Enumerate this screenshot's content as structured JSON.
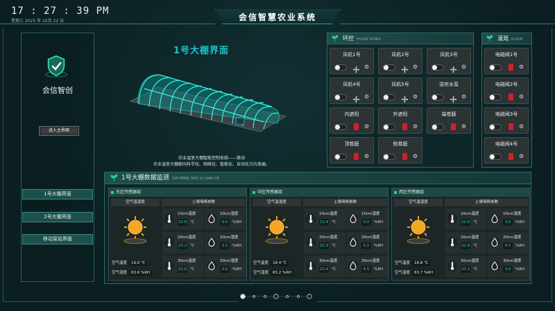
{
  "header": {
    "time": "17 : 27 : 39  PM",
    "date": "星期三    2025 年 10月 22 日",
    "title": "会信智慧农业系统"
  },
  "left": {
    "brand": "会信智创",
    "enter_button": "进入主界面",
    "nav": [
      "1号大棚界面",
      "2号大棚界面",
      "移动泵站界面"
    ]
  },
  "greenhouse": {
    "title": "1号大棚界面",
    "desc_line1": "农业温室大棚智能控制系统——推动",
    "desc_line2": "农业温室大棚朝向科学化、网络化、智能化、自动化方向发展。"
  },
  "env": {
    "title": "环控",
    "subtitle": "HUAN KONG",
    "items": [
      {
        "label": "风机1号",
        "icon": "fan-icon"
      },
      {
        "label": "风机2号",
        "icon": "fan-icon"
      },
      {
        "label": "风机3号",
        "icon": "fan-icon"
      },
      {
        "label": "风机4号",
        "icon": "fan-icon"
      },
      {
        "label": "风机5号",
        "icon": "fan-icon"
      },
      {
        "label": "湿帘水泵",
        "icon": "fan-icon"
      },
      {
        "label": "内遮阳",
        "icon": "valve-icon"
      },
      {
        "label": "外遮阳",
        "icon": "valve-icon"
      },
      {
        "label": "端卷膜",
        "icon": "valve-icon"
      },
      {
        "label": "顶卷膜",
        "icon": "valve-icon"
      },
      {
        "label": "侧卷膜",
        "icon": "valve-icon"
      }
    ]
  },
  "irrigation": {
    "title": "灌溉",
    "subtitle": "GUAN GAI",
    "items": [
      "电磁阀1号",
      "电磁阀2号",
      "电磁阀3号",
      "电磁阀4号"
    ]
  },
  "monitor": {
    "title": "1号大棚数据监测",
    "subtitle": "DA PENG SHU JV JIAN CE",
    "air_header": "空气温湿度",
    "soil_header": "土壤墒情参数",
    "air_temp_label": "空气温度",
    "air_hum_label": "空气湿度",
    "temp_unit": "℃",
    "hum_unit": "%RH",
    "zones": [
      {
        "name": "东区传感器组",
        "air_temp": "19.0",
        "air_hum": "63.6",
        "soil": [
          {
            "label": "10cm温度",
            "value": "22.8",
            "kind": "temp"
          },
          {
            "label": "10cm湿度",
            "value": "0.0",
            "kind": "hum"
          },
          {
            "label": "20cm温度",
            "value": "23.2",
            "kind": "temp"
          },
          {
            "label": "20cm湿度",
            "value": "3.1",
            "kind": "hum"
          },
          {
            "label": "30cm温度",
            "value": "22.8",
            "kind": "temp"
          },
          {
            "label": "30cm湿度",
            "value": "0.0",
            "kind": "hum"
          }
        ]
      },
      {
        "name": "中区传感器组",
        "air_temp": "18.4",
        "air_hum": "65.2",
        "soil": [
          {
            "label": "10cm温度",
            "value": "22.4",
            "kind": "temp"
          },
          {
            "label": "10cm湿度",
            "value": "0.0",
            "kind": "hum"
          },
          {
            "label": "20cm温度",
            "value": "22.3",
            "kind": "temp"
          },
          {
            "label": "20cm湿度",
            "value": "5.1",
            "kind": "hum"
          },
          {
            "label": "30cm温度",
            "value": "22.4",
            "kind": "temp"
          },
          {
            "label": "30cm湿度",
            "value": "4.5",
            "kind": "hum"
          }
        ]
      },
      {
        "name": "西区传感器组",
        "air_temp": "18.8",
        "air_hum": "63.7",
        "soil": [
          {
            "label": "10cm温度",
            "value": "22.0",
            "kind": "temp"
          },
          {
            "label": "10cm湿度",
            "value": "3.6",
            "kind": "hum"
          },
          {
            "label": "20cm温度",
            "value": "22.8",
            "kind": "temp"
          },
          {
            "label": "20cm湿度",
            "value": "4.1",
            "kind": "hum"
          },
          {
            "label": "30cm温度",
            "value": "23.1",
            "kind": "temp"
          },
          {
            "label": "30cm湿度",
            "value": "3.6",
            "kind": "hum"
          }
        ]
      }
    ]
  },
  "pager": {
    "pages": 7,
    "current": 0
  },
  "colors": {
    "accent": "#19c4c8",
    "valve": "#d21f2a",
    "panel": "#2c3334"
  }
}
